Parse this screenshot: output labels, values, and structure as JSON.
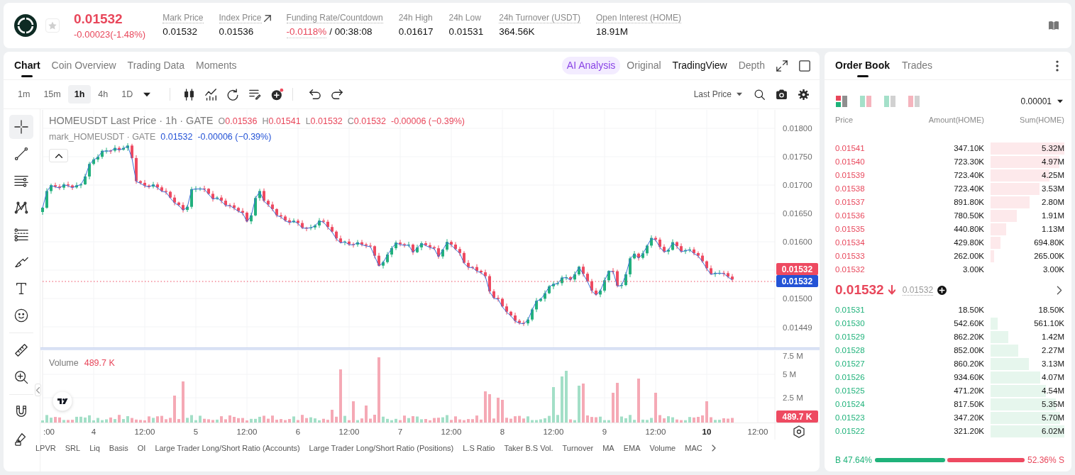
{
  "header": {
    "price": "0.01532",
    "change": "-0.00023(-1.48%)",
    "favorite": false,
    "stats": [
      {
        "kind": "value",
        "label": "Mark Price",
        "hint": true,
        "link": false,
        "value": "0.01532"
      },
      {
        "kind": "value",
        "label": "Index Price",
        "hint": true,
        "link": true,
        "value": "0.01536"
      },
      {
        "kind": "funding",
        "label": "Funding Rate/Countdown",
        "hint": true,
        "link": false,
        "rate": "-0.0118%",
        "countdown": "/ 00:38:08"
      },
      {
        "kind": "value",
        "label": "24h High",
        "hint": false,
        "link": false,
        "value": "0.01617"
      },
      {
        "kind": "value",
        "label": "24h Low",
        "hint": false,
        "link": false,
        "value": "0.01531"
      },
      {
        "kind": "value",
        "label": "24h Turnover (USDT)",
        "hint": true,
        "link": false,
        "value": "364.56K"
      },
      {
        "kind": "value",
        "label": "Open Interest (HOME)",
        "hint": true,
        "link": false,
        "value": "18.91M"
      }
    ]
  },
  "chart_panel": {
    "tabs": [
      {
        "label": "Chart",
        "selected": true
      },
      {
        "label": "Coin Overview",
        "selected": false
      },
      {
        "label": "Trading Data",
        "selected": false
      },
      {
        "label": "Moments",
        "selected": false
      }
    ],
    "views": [
      {
        "kind": "ai",
        "label": "AI Analysis",
        "selected": false
      },
      {
        "kind": "plain",
        "label": "Original",
        "selected": false
      },
      {
        "kind": "plain",
        "label": "TradingView",
        "selected": true
      },
      {
        "kind": "plain",
        "label": "Depth",
        "selected": false
      }
    ],
    "intervals": [
      {
        "label": "1m",
        "selected": false
      },
      {
        "label": "15m",
        "selected": false
      },
      {
        "label": "1h",
        "selected": true
      },
      {
        "label": "4h",
        "selected": false
      },
      {
        "label": "1D",
        "selected": false
      }
    ],
    "price_source": "Last Price",
    "drawing_tools": [
      {
        "selected": true
      },
      {
        "selected": false
      },
      {
        "selected": false
      },
      {
        "selected": false
      },
      {
        "selected": false
      },
      {
        "selected": false
      },
      {
        "selected": false
      },
      {
        "selected": false
      },
      {
        "selected": false
      },
      {
        "selected": false
      },
      {
        "selected": false
      },
      {
        "selected": false
      }
    ],
    "legend": {
      "title": "HOMEUSDT Last Price · 1h · GATE",
      "ohlc": [
        {
          "key": "O",
          "value": "0.01536"
        },
        {
          "key": "H",
          "value": "0.01541"
        },
        {
          "key": "L",
          "value": "0.01532"
        },
        {
          "key": "C",
          "value": "0.01532"
        }
      ],
      "change": "-0.00006 (−0.39%)"
    },
    "mark_legend": {
      "title": "mark_HOMEUSDT · GATE",
      "value": "0.01532",
      "change": "-0.00006 (−0.39%)"
    },
    "price_axis": [
      "0.01800",
      "0.01750",
      "0.01700",
      "0.01650",
      "0.01600",
      "0.01500",
      "0.01449"
    ],
    "last_price_tag": "0.01532",
    "mark_price_tag": "0.01532",
    "volume": {
      "label": "Volume",
      "value": "489.7 K",
      "axis": [
        "7.5 M",
        "5 M",
        "2.5 M"
      ],
      "tag": "489.7 K"
    },
    "time_axis": [
      {
        "label": ":00",
        "current": false
      },
      {
        "label": "4",
        "current": false
      },
      {
        "label": "12:00",
        "current": false
      },
      {
        "label": "5",
        "current": false
      },
      {
        "label": "12:00",
        "current": false
      },
      {
        "label": "6",
        "current": false
      },
      {
        "label": "12:00",
        "current": false
      },
      {
        "label": "7",
        "current": false
      },
      {
        "label": "12:00",
        "current": false
      },
      {
        "label": "8",
        "current": false
      },
      {
        "label": "12:00",
        "current": false
      },
      {
        "label": "9",
        "current": false
      },
      {
        "label": "12:00",
        "current": false
      },
      {
        "label": "10",
        "current": true
      },
      {
        "label": "12:00",
        "current": false
      }
    ],
    "indicators": [
      "LPVR",
      "SRL",
      "Liq",
      "Basis",
      "OI",
      "Large Trader Long/Short Ratio (Accounts)",
      "Large Trader Long/Short Ratio (Positions)",
      "L.S Ratio",
      "Taker B.S Vol.",
      "Turnover",
      "MA",
      "EMA",
      "Volume",
      "MAC"
    ]
  },
  "order_book": {
    "tabs": [
      {
        "label": "Order Book",
        "selected": true
      },
      {
        "label": "Trades",
        "selected": false
      }
    ],
    "layouts": [
      {
        "selected": true
      },
      {
        "selected": false
      },
      {
        "selected": false
      },
      {
        "selected": false
      }
    ],
    "precision": "0.00001",
    "columns": [
      "Price",
      "Amount(HOME)",
      "Sum(HOME)"
    ],
    "asks": [
      {
        "price": "0.01541",
        "amount": "347.10K",
        "sum": "5.32M"
      },
      {
        "price": "0.01540",
        "amount": "723.30K",
        "sum": "4.97M"
      },
      {
        "price": "0.01539",
        "amount": "723.40K",
        "sum": "4.25M"
      },
      {
        "price": "0.01538",
        "amount": "723.40K",
        "sum": "3.53M"
      },
      {
        "price": "0.01537",
        "amount": "891.80K",
        "sum": "2.80M"
      },
      {
        "price": "0.01536",
        "amount": "780.50K",
        "sum": "1.91M"
      },
      {
        "price": "0.01535",
        "amount": "440.80K",
        "sum": "1.13M"
      },
      {
        "price": "0.01534",
        "amount": "429.80K",
        "sum": "694.80K"
      },
      {
        "price": "0.01533",
        "amount": "262.00K",
        "sum": "265.00K"
      },
      {
        "price": "0.01532",
        "amount": "3.00K",
        "sum": "3.00K"
      }
    ],
    "last_price": "0.01532",
    "mark_price": "0.01532",
    "bids": [
      {
        "price": "0.01531",
        "amount": "18.50K",
        "sum": "18.50K"
      },
      {
        "price": "0.01530",
        "amount": "542.60K",
        "sum": "561.10K"
      },
      {
        "price": "0.01529",
        "amount": "862.20K",
        "sum": "1.42M"
      },
      {
        "price": "0.01528",
        "amount": "852.00K",
        "sum": "2.27M"
      },
      {
        "price": "0.01527",
        "amount": "860.20K",
        "sum": "3.13M"
      },
      {
        "price": "0.01526",
        "amount": "934.60K",
        "sum": "4.07M"
      },
      {
        "price": "0.01525",
        "amount": "471.20K",
        "sum": "4.54M"
      },
      {
        "price": "0.01524",
        "amount": "817.50K",
        "sum": "5.35M"
      },
      {
        "price": "0.01523",
        "amount": "347.20K",
        "sum": "5.70M"
      },
      {
        "price": "0.01522",
        "amount": "321.20K",
        "sum": "6.02M"
      }
    ],
    "ratio": {
      "buy": "B 47.64%",
      "sell": "52.36% S",
      "level": 0.4764
    }
  }
}
